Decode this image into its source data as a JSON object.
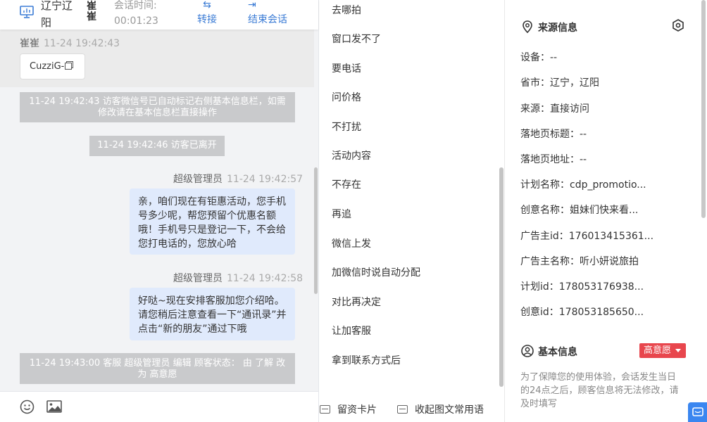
{
  "header": {
    "location": "辽宁辽阳",
    "user_name": "崔崔",
    "session_time_label": "会话时间:",
    "session_time_value": "00:01:23",
    "transfer_label": "转接",
    "end_label": "结束会话",
    "accent_color": "#3a7bd5"
  },
  "chat": {
    "visitor_name": "崔崔",
    "visitor_time": "11-24 19:42:43",
    "card_label": "CuzziG-",
    "system_messages": [
      "11-24 19:42:43 访客微信号已自动标记右侧基本信息栏，如需修改请在基本信息栏直接操作",
      "11-24 19:42:46 访客已离开",
      "11-24 19:43:00 客服 超级管理员 编辑 顾客状态： 由 了解 改为 高意愿"
    ],
    "messages": [
      {
        "sender": "超级管理员",
        "time": "11-24 19:42:57",
        "text": "亲，咱们现在有钜惠活动，您手机号多少呢，帮您预留个优惠名额哦！手机号只是登记一下，不会给您打电话的，您放心哈"
      },
      {
        "sender": "超级管理员",
        "time": "11-24 19:42:58",
        "text": "好哒~现在安排客服加您介绍哈。请您稍后注意查看一下“通讯录”并点击“新的朋友”通过下哦"
      }
    ]
  },
  "quick_replies": {
    "items": [
      "去哪拍",
      "窗口发不了",
      "要电话",
      "问价格",
      "不打扰",
      "活动内容",
      "不存在",
      "再追",
      "微信上发",
      "加微信时说自动分配",
      "对比再决定",
      "让加客服",
      "拿到联系方式后"
    ],
    "footer_card": "留资卡片",
    "footer_collapse": "收起图文常用语"
  },
  "source_info": {
    "title": "来源信息",
    "rows": [
      "设备：--",
      "省市：辽宁，辽阳",
      "来源：直接访问",
      "落地页标题：--",
      "落地页地址：--",
      "计划名称：cdp_promotio...",
      "创意名称：姐妹们快来看...",
      "广告主id：176013415361...",
      "广告主名称：听小妍说旅拍",
      "计划id：178053176938...",
      "创意id：178053185650..."
    ]
  },
  "basic_info": {
    "title": "基本信息",
    "intent_badge": "高意愿",
    "badge_color": "#e8464d",
    "note": "为了保障您的使用体验，会话发生当日的24点之后，顾客信息将无法修改，请及时填写"
  }
}
